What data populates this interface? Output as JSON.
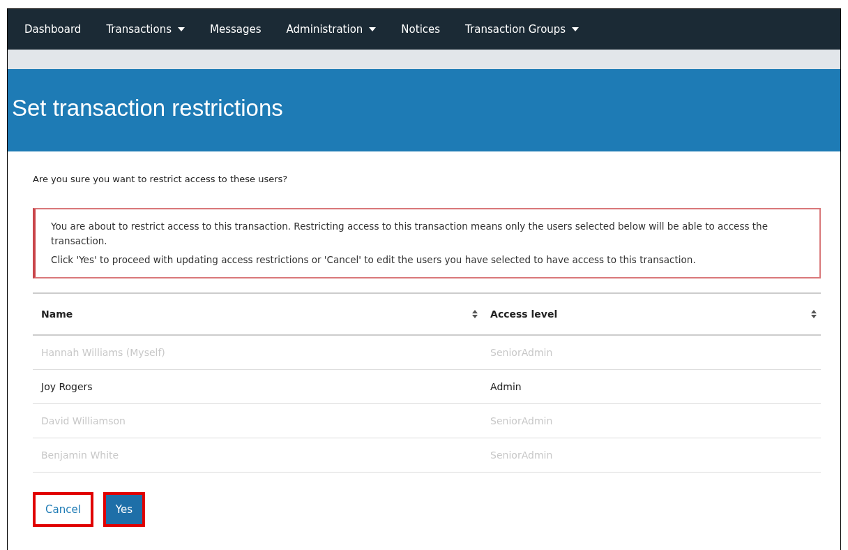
{
  "nav": [
    {
      "label": "Dashboard",
      "dropdown": false
    },
    {
      "label": "Transactions",
      "dropdown": true
    },
    {
      "label": "Messages",
      "dropdown": false
    },
    {
      "label": "Administration",
      "dropdown": true
    },
    {
      "label": "Notices",
      "dropdown": false
    },
    {
      "label": "Transaction Groups",
      "dropdown": true
    }
  ],
  "page_title": "Set transaction restrictions",
  "question": "Are you sure you want to restrict access to these users?",
  "alert": [
    "You are about to restrict access to this transaction. Restricting access to this transaction means only the users selected below will be able to access the transaction.",
    "Click 'Yes' to proceed with updating access restrictions or 'Cancel' to edit the users you have selected to have access to this transaction."
  ],
  "table": {
    "columns": [
      "Name",
      "Access level"
    ],
    "rows": [
      {
        "cells": [
          "Hannah Williams (Myself)",
          "SeniorAdmin"
        ],
        "disabled": true
      },
      {
        "cells": [
          "Joy Rogers",
          "Admin"
        ],
        "disabled": false
      },
      {
        "cells": [
          "David Williamson",
          "SeniorAdmin"
        ],
        "disabled": true
      },
      {
        "cells": [
          "Benjamin White",
          "SeniorAdmin"
        ],
        "disabled": true
      }
    ]
  },
  "buttons": [
    {
      "label": "Cancel",
      "kind": "link",
      "highlighted": true
    },
    {
      "label": "Yes",
      "kind": "primary",
      "highlighted": true
    }
  ]
}
